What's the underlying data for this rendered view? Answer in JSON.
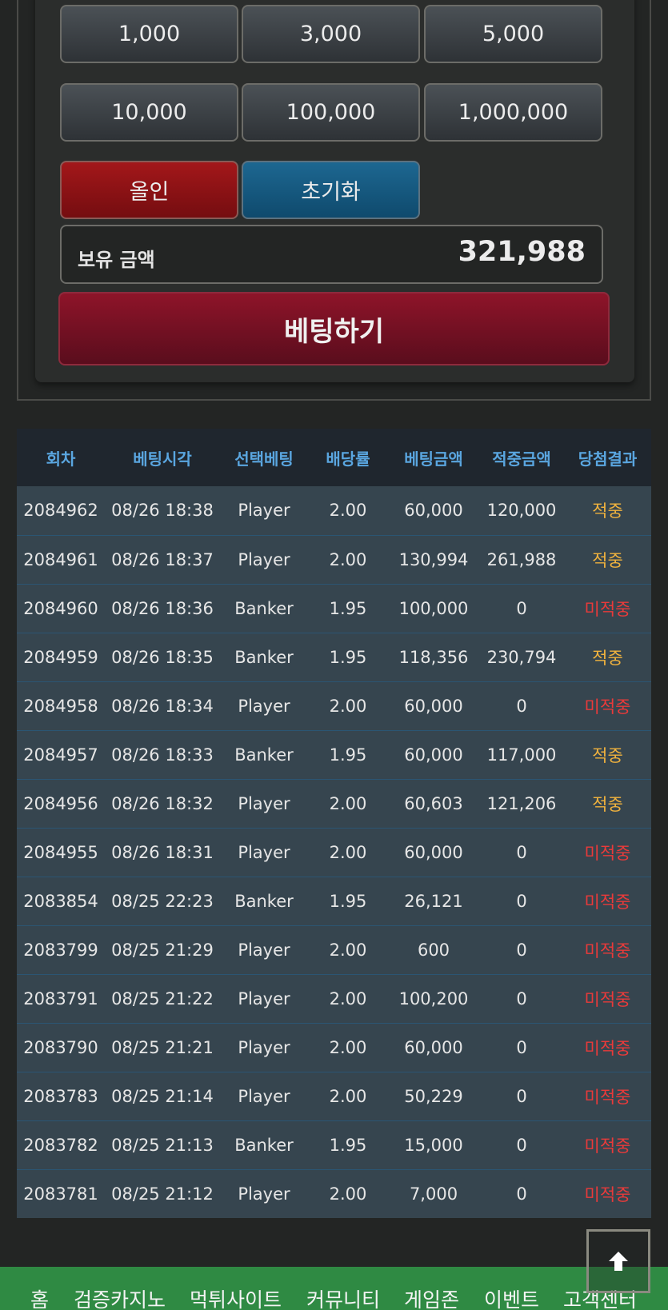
{
  "chips": [
    "1,000",
    "3,000",
    "5,000",
    "10,000",
    "100,000",
    "1,000,000"
  ],
  "actions": {
    "allin": "올인",
    "reset": "초기화"
  },
  "balance": {
    "label": "보유 금액",
    "value": "321,988"
  },
  "submit_label": "베팅하기",
  "colors": {
    "win": "#f0b23e",
    "lose": "#ea3a3a",
    "header_text": "#5aa6e0"
  },
  "history": {
    "headers": [
      "회차",
      "베팅시각",
      "선택베팅",
      "배당률",
      "베팅금액",
      "적중금액",
      "당첨결과"
    ],
    "rows": [
      [
        "2084962",
        "08/26 18:38",
        "Player",
        "2.00",
        "60,000",
        "120,000",
        "적중"
      ],
      [
        "2084961",
        "08/26 18:37",
        "Player",
        "2.00",
        "130,994",
        "261,988",
        "적중"
      ],
      [
        "2084960",
        "08/26 18:36",
        "Banker",
        "1.95",
        "100,000",
        "0",
        "미적중"
      ],
      [
        "2084959",
        "08/26 18:35",
        "Banker",
        "1.95",
        "118,356",
        "230,794",
        "적중"
      ],
      [
        "2084958",
        "08/26 18:34",
        "Player",
        "2.00",
        "60,000",
        "0",
        "미적중"
      ],
      [
        "2084957",
        "08/26 18:33",
        "Banker",
        "1.95",
        "60,000",
        "117,000",
        "적중"
      ],
      [
        "2084956",
        "08/26 18:32",
        "Player",
        "2.00",
        "60,603",
        "121,206",
        "적중"
      ],
      [
        "2084955",
        "08/26 18:31",
        "Player",
        "2.00",
        "60,000",
        "0",
        "미적중"
      ],
      [
        "2083854",
        "08/25 22:23",
        "Banker",
        "1.95",
        "26,121",
        "0",
        "미적중"
      ],
      [
        "2083799",
        "08/25 21:29",
        "Player",
        "2.00",
        "600",
        "0",
        "미적중"
      ],
      [
        "2083791",
        "08/25 21:22",
        "Player",
        "2.00",
        "100,200",
        "0",
        "미적중"
      ],
      [
        "2083790",
        "08/25 21:21",
        "Player",
        "2.00",
        "60,000",
        "0",
        "미적중"
      ],
      [
        "2083783",
        "08/25 21:14",
        "Player",
        "2.00",
        "50,229",
        "0",
        "미적중"
      ],
      [
        "2083782",
        "08/25 21:13",
        "Banker",
        "1.95",
        "15,000",
        "0",
        "미적중"
      ],
      [
        "2083781",
        "08/25 21:12",
        "Player",
        "2.00",
        "7,000",
        "0",
        "미적중"
      ]
    ]
  },
  "nav": [
    "홈",
    "검증카지노",
    "먹튀사이트",
    "커뮤니티",
    "게임존",
    "이벤트",
    "고객센터"
  ],
  "to_top_icon": "arrow-up-icon"
}
